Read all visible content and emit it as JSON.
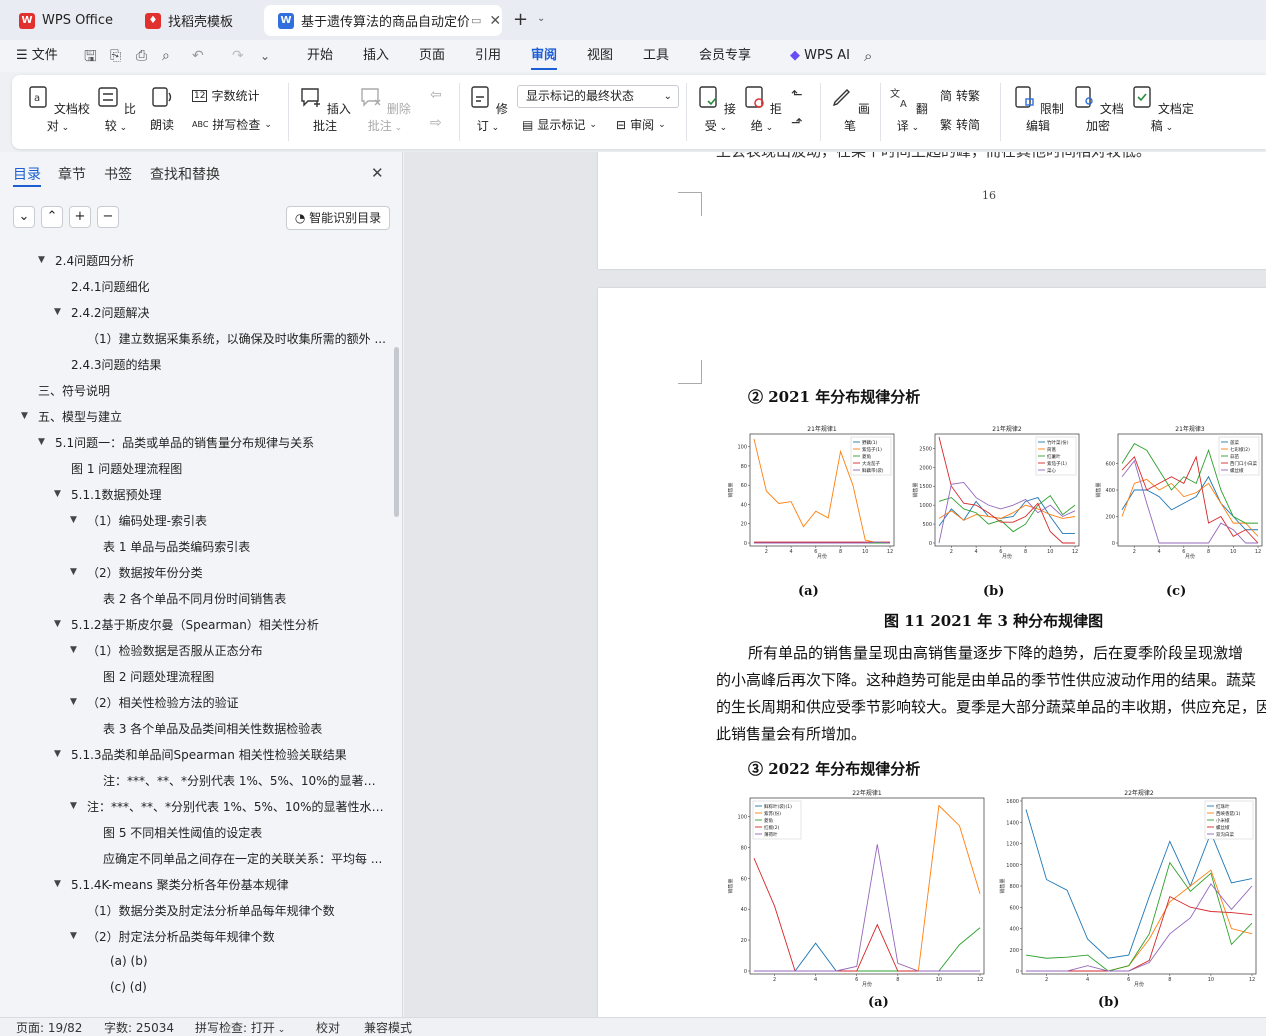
{
  "tabs": [
    {
      "label": "WPS Office",
      "color": "#e0312f"
    },
    {
      "label": "找稻壳模板",
      "color": "#e0312f"
    },
    {
      "label": "基于遗传算法的商品自动定价与"
    }
  ],
  "menubar": {
    "file": "文件",
    "items": [
      "开始",
      "插入",
      "页面",
      "引用",
      "审阅",
      "视图",
      "工具",
      "会员专享"
    ],
    "ai": "WPS AI"
  },
  "ribbon": {
    "proofread": "文档校对",
    "compare": "比较",
    "read": "朗读",
    "wordcount": "字数统计",
    "spellcheck": "拼写检查",
    "insert_comment": "插入批注",
    "delete_comment": "删除批注",
    "track": "修订",
    "markup_dropdown": "显示标记的最终状态",
    "show_markup": "显示标记",
    "review": "审阅",
    "accept": "接受",
    "reject": "拒绝",
    "pen": "画笔",
    "translate": "翻译",
    "to_traditional": "转繁",
    "to_simplified": "转简",
    "restrict": "限制编辑",
    "encrypt": "文档加密",
    "finalize": "文档定稿"
  },
  "nav": {
    "tabs": [
      "目录",
      "章节",
      "书签",
      "查找和替换"
    ],
    "smart": "智能识别目录",
    "toc": [
      {
        "t": "2.4问题四分析",
        "lv": 1,
        "exp": true
      },
      {
        "t": "2.4.1问题细化",
        "lv": 2
      },
      {
        "t": "2.4.2问题解决",
        "lv": 2,
        "exp": true
      },
      {
        "t": "（1）建立数据采集系统，以确保及时收集所需的额外 ...",
        "lv": 3
      },
      {
        "t": "2.4.3问题的结果",
        "lv": 2
      },
      {
        "t": "三、符号说明",
        "lv": 0
      },
      {
        "t": "五、模型与建立",
        "lv": 0,
        "exp": true
      },
      {
        "t": "5.1问题一：品类或单品的销售量分布规律与关系",
        "lv": 1,
        "exp": true
      },
      {
        "t": "图 1  问题处理流程图",
        "lv": 2
      },
      {
        "t": "5.1.1数据预处理",
        "lv": 2,
        "exp": true
      },
      {
        "t": "（1）编码处理-索引表",
        "lv": 3,
        "exp": true
      },
      {
        "t": "表 1  单品与品类编码索引表",
        "lv": 4
      },
      {
        "t": "（2）数据按年份分类",
        "lv": 3,
        "exp": true
      },
      {
        "t": "表 2  各个单品不同月份时间销售表",
        "lv": 4
      },
      {
        "t": "5.1.2基于斯皮尔曼（Spearman）相关性分析",
        "lv": 2,
        "exp": true
      },
      {
        "t": "（1）检验数据是否服从正态分布",
        "lv": 3,
        "exp": true
      },
      {
        "t": "图 2  问题处理流程图",
        "lv": 4
      },
      {
        "t": "（2）相关性检验方法的验证",
        "lv": 3,
        "exp": true
      },
      {
        "t": "表 3  各个单品及品类间相关性数据检验表",
        "lv": 4
      },
      {
        "t": "5.1.3品类和单品间Spearman 相关性检验关联结果",
        "lv": 2,
        "exp": true
      },
      {
        "t": "注：***、**、*分别代表 1%、5%、10%的显著性 ...",
        "lv": 4
      },
      {
        "t": "注：***、**、*分别代表 1%、5%、10%的显著性水 ...",
        "lv": 3,
        "exp": true
      },
      {
        "t": "图 5  不同相关性阈值的设定表",
        "lv": 4
      },
      {
        "t": "应确定不同单品之间存在一定的关联关系：平均每 ...",
        "lv": 4
      },
      {
        "t": "5.1.4K-means 聚类分析各年份基本规律",
        "lv": 2,
        "exp": true
      },
      {
        "t": "（1）数据分类及肘定法分析单品每年规律个数",
        "lv": 3
      },
      {
        "t": "（2）肘定法分析品类每年规律个数",
        "lv": 3,
        "exp": true
      },
      {
        "t": "(a)      (b)",
        "lv": 5
      },
      {
        "t": "(c)      (d)",
        "lv": 5
      }
    ]
  },
  "doc": {
    "top_line": "上会表现出波动，在某个时间上起的峰，而在其他时间相对较低。",
    "page_number": "16",
    "heading2021": "② 2021 年分布规律分析",
    "fig11_caption": "图 11   2021 年 3 种分布规律图",
    "sub_labels_2021": [
      "(a)",
      "(b)",
      "(c)"
    ],
    "paragraph_lines": [
      "所有单品的销售量呈现由高销售量逐步下降的趋势，后在夏季阶段呈现激增",
      "的小高峰后再次下降。这种趋势可能是由单品的季节性供应波动作用的结果。蔬菜",
      "的生长周期和供应受季节影响较大。夏季是大部分蔬菜单品的丰收期，供应充足，因",
      "此销售量会有所增加。"
    ],
    "heading2022": "③ 2022 年分布规律分析",
    "sub_labels_2022": [
      "(a)",
      "(b)"
    ]
  },
  "chart_data": [
    {
      "type": "line",
      "title": "21年规律1",
      "xlabel": "月份",
      "ylabel": "销售量",
      "xlim": [
        1,
        12
      ],
      "ylim": [
        0,
        110
      ],
      "yticks": [
        0,
        20,
        40,
        60,
        80,
        100
      ],
      "xticks": [
        2,
        4,
        6,
        8,
        10,
        12
      ],
      "legend": "top-right",
      "x": [
        1,
        2,
        3,
        4,
        5,
        6,
        7,
        8,
        9,
        10,
        11,
        12
      ],
      "series": [
        {
          "name": "野藕(1)",
          "color": "#1f77b4",
          "values": [
            0,
            0,
            0,
            0,
            0,
            0,
            0,
            0,
            0,
            0,
            0,
            0
          ]
        },
        {
          "name": "紫茄子(1)",
          "color": "#ff7f0e",
          "values": [
            108,
            54,
            41,
            43,
            17,
            33,
            26,
            95,
            60,
            3,
            0,
            0
          ]
        },
        {
          "name": "菱角",
          "color": "#2ca02c",
          "values": [
            0,
            0,
            0,
            0,
            0,
            0,
            0,
            0,
            0,
            0,
            0,
            0
          ]
        },
        {
          "name": "大龙茄子",
          "color": "#d62728",
          "values": [
            1,
            1,
            1,
            1,
            1,
            1,
            1,
            1,
            1,
            1,
            1,
            1
          ]
        },
        {
          "name": "鲜藕带(袋)",
          "color": "#9467bd",
          "values": [
            0,
            0,
            0,
            0,
            0,
            0,
            0,
            0,
            0,
            0,
            1,
            0
          ]
        }
      ]
    },
    {
      "type": "line",
      "title": "21年规律2",
      "xlabel": "月份",
      "ylabel": "销售量",
      "xlim": [
        1,
        12
      ],
      "ylim": [
        0,
        2800
      ],
      "yticks": [
        0,
        500,
        1000,
        1500,
        2000,
        2500
      ],
      "xticks": [
        2,
        4,
        6,
        8,
        10,
        12
      ],
      "legend": "top-right",
      "x": [
        1,
        2,
        3,
        4,
        5,
        6,
        7,
        8,
        9,
        10,
        11,
        12
      ],
      "series": [
        {
          "name": "竹叶菜(份)",
          "color": "#1f77b4",
          "values": [
            450,
            900,
            600,
            1100,
            700,
            650,
            700,
            1100,
            1200,
            700,
            250,
            250
          ]
        },
        {
          "name": "茼蒿",
          "color": "#ff7f0e",
          "values": [
            650,
            850,
            600,
            750,
            700,
            650,
            800,
            1000,
            900,
            750,
            650,
            700
          ]
        },
        {
          "name": "红薯叶",
          "color": "#2ca02c",
          "values": [
            1100,
            1200,
            900,
            800,
            500,
            600,
            300,
            500,
            1000,
            1250,
            750,
            1000
          ]
        },
        {
          "name": "紫茄子(1)",
          "color": "#d62728",
          "values": [
            2800,
            1500,
            1050,
            1000,
            800,
            550,
            550,
            700,
            1050,
            300,
            0,
            0
          ]
        },
        {
          "name": "菜心",
          "color": "#9467bd",
          "values": [
            0,
            1550,
            1600,
            1200,
            1000,
            900,
            1000,
            1150,
            800,
            1000,
            700,
            850
          ]
        }
      ]
    },
    {
      "type": "line",
      "title": "21年规律3",
      "xlabel": "月份",
      "ylabel": "销售量",
      "xlim": [
        1,
        12
      ],
      "ylim": [
        0,
        800
      ],
      "yticks": [
        0,
        200,
        400,
        600
      ],
      "xticks": [
        2,
        4,
        6,
        8,
        10,
        12
      ],
      "legend": "top-right",
      "x": [
        1,
        2,
        3,
        4,
        5,
        6,
        7,
        8,
        9,
        10,
        11,
        12
      ],
      "series": [
        {
          "name": "菠菜",
          "color": "#1f77b4",
          "values": [
            250,
            400,
            400,
            350,
            250,
            300,
            350,
            500,
            300,
            200,
            100,
            100
          ]
        },
        {
          "name": "七彩椒(2)",
          "color": "#ff7f0e",
          "values": [
            200,
            450,
            480,
            400,
            450,
            350,
            380,
            450,
            300,
            150,
            150,
            50
          ]
        },
        {
          "name": "蒜苗",
          "color": "#2ca02c",
          "values": [
            600,
            750,
            700,
            550,
            400,
            500,
            450,
            700,
            400,
            200,
            150,
            150
          ]
        },
        {
          "name": "西门口小白菜",
          "color": "#d62728",
          "values": [
            550,
            650,
            400,
            450,
            500,
            450,
            650,
            150,
            200,
            50,
            100,
            0
          ]
        },
        {
          "name": "螺丝椒",
          "color": "#9467bd",
          "values": [
            500,
            620,
            300,
            0,
            0,
            0,
            0,
            0,
            150,
            100,
            0,
            0
          ]
        }
      ]
    },
    {
      "type": "line",
      "title": "22年规律1",
      "xlabel": "月份",
      "ylabel": "销售量",
      "xlim": [
        1,
        12
      ],
      "ylim": [
        0,
        110
      ],
      "yticks": [
        0,
        20,
        40,
        60,
        80,
        100
      ],
      "xticks": [
        2,
        4,
        6,
        8,
        10,
        12
      ],
      "legend": "top-left",
      "x": [
        1,
        2,
        3,
        4,
        5,
        6,
        7,
        8,
        9,
        10,
        11,
        12
      ],
      "series": [
        {
          "name": "鲜粽叶(袋)(1)",
          "color": "#1f77b4",
          "values": [
            0,
            0,
            0,
            18,
            0,
            0,
            0,
            0,
            0,
            0,
            0,
            0
          ]
        },
        {
          "name": "紫苏(份)",
          "color": "#ff7f0e",
          "values": [
            0,
            0,
            0,
            0,
            0,
            0,
            0,
            0,
            0,
            107,
            94,
            50
          ]
        },
        {
          "name": "菱角",
          "color": "#2ca02c",
          "values": [
            0,
            0,
            0,
            0,
            0,
            0,
            0,
            0,
            0,
            0,
            17,
            28
          ]
        },
        {
          "name": "红椒(2)",
          "color": "#d62728",
          "values": [
            73,
            42,
            0,
            0,
            0,
            0,
            30,
            0,
            0,
            0,
            0,
            0
          ]
        },
        {
          "name": "薄荷叶",
          "color": "#9467bd",
          "values": [
            0,
            0,
            0,
            0,
            0,
            3,
            82,
            5,
            0,
            0,
            0,
            0
          ]
        }
      ]
    },
    {
      "type": "line",
      "title": "22年规律2",
      "xlabel": "月份",
      "ylabel": "销售量",
      "xlim": [
        1,
        12
      ],
      "ylim": [
        0,
        1600
      ],
      "yticks": [
        0,
        200,
        400,
        600,
        800,
        1000,
        1200,
        1400,
        1600
      ],
      "xticks": [
        2,
        4,
        6,
        8,
        10,
        12
      ],
      "legend": "top-right",
      "x": [
        1,
        2,
        3,
        4,
        5,
        6,
        7,
        8,
        9,
        10,
        11,
        12
      ],
      "series": [
        {
          "name": "红珠叶",
          "color": "#1f77b4",
          "values": [
            1520,
            860,
            760,
            300,
            120,
            150,
            700,
            1220,
            800,
            1300,
            830,
            870
          ]
        },
        {
          "name": "西峡香菇(1)",
          "color": "#ff7f0e",
          "values": [
            0,
            0,
            0,
            0,
            0,
            50,
            300,
            650,
            800,
            950,
            400,
            350
          ]
        },
        {
          "name": "小米椒",
          "color": "#2ca02c",
          "values": [
            150,
            120,
            130,
            150,
            0,
            50,
            350,
            1020,
            750,
            920,
            250,
            450
          ]
        },
        {
          "name": "螺丝椒",
          "color": "#d62728",
          "values": [
            0,
            0,
            0,
            0,
            0,
            0,
            100,
            700,
            600,
            560,
            550,
            530
          ]
        },
        {
          "name": "双沟白菜",
          "color": "#9467bd",
          "values": [
            0,
            0,
            0,
            50,
            0,
            0,
            80,
            350,
            500,
            820,
            580,
            800
          ]
        }
      ]
    }
  ],
  "status": {
    "page": "页面: 19/82",
    "words": "字数: 25034",
    "spell": "拼写检查: 打开",
    "proof": "校对",
    "compat": "兼容模式"
  }
}
